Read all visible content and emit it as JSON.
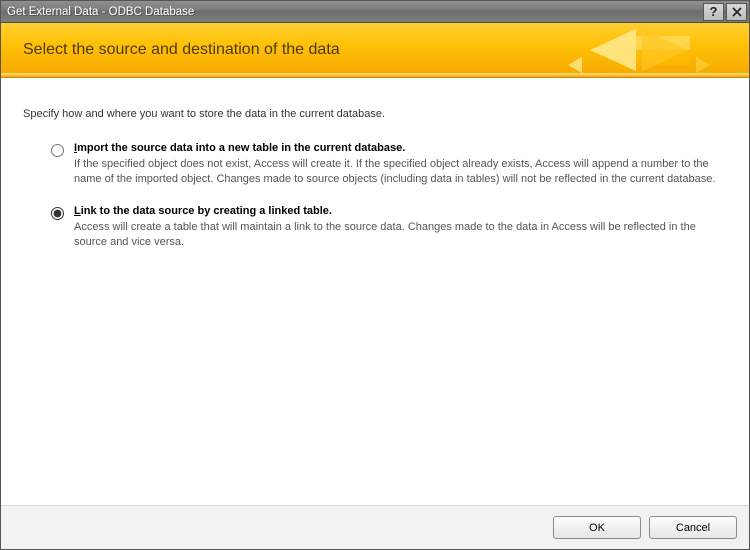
{
  "title": "Get External Data - ODBC Database",
  "banner_title": "Select the source and destination of the data",
  "intro": "Specify how and where you want to store the data in the current database.",
  "options": {
    "import": {
      "mnemonic": "I",
      "label_rest": "mport the source data into a new table in the current database.",
      "desc": "If the specified object does not exist, Access will create it. If the specified object already exists, Access will append a number to the name of the imported object. Changes made to source objects (including data in tables) will not be reflected in the current database.",
      "selected": false
    },
    "link": {
      "mnemonic": "L",
      "label_rest": "ink to the data source by creating a linked table.",
      "desc": "Access will create a table that will maintain a link to the source data. Changes made to the data in Access will be reflected in the source and vice versa.",
      "selected": true
    }
  },
  "buttons": {
    "ok": "OK",
    "cancel": "Cancel"
  },
  "titlebar_icons": {
    "help": "?",
    "close": "✕"
  }
}
